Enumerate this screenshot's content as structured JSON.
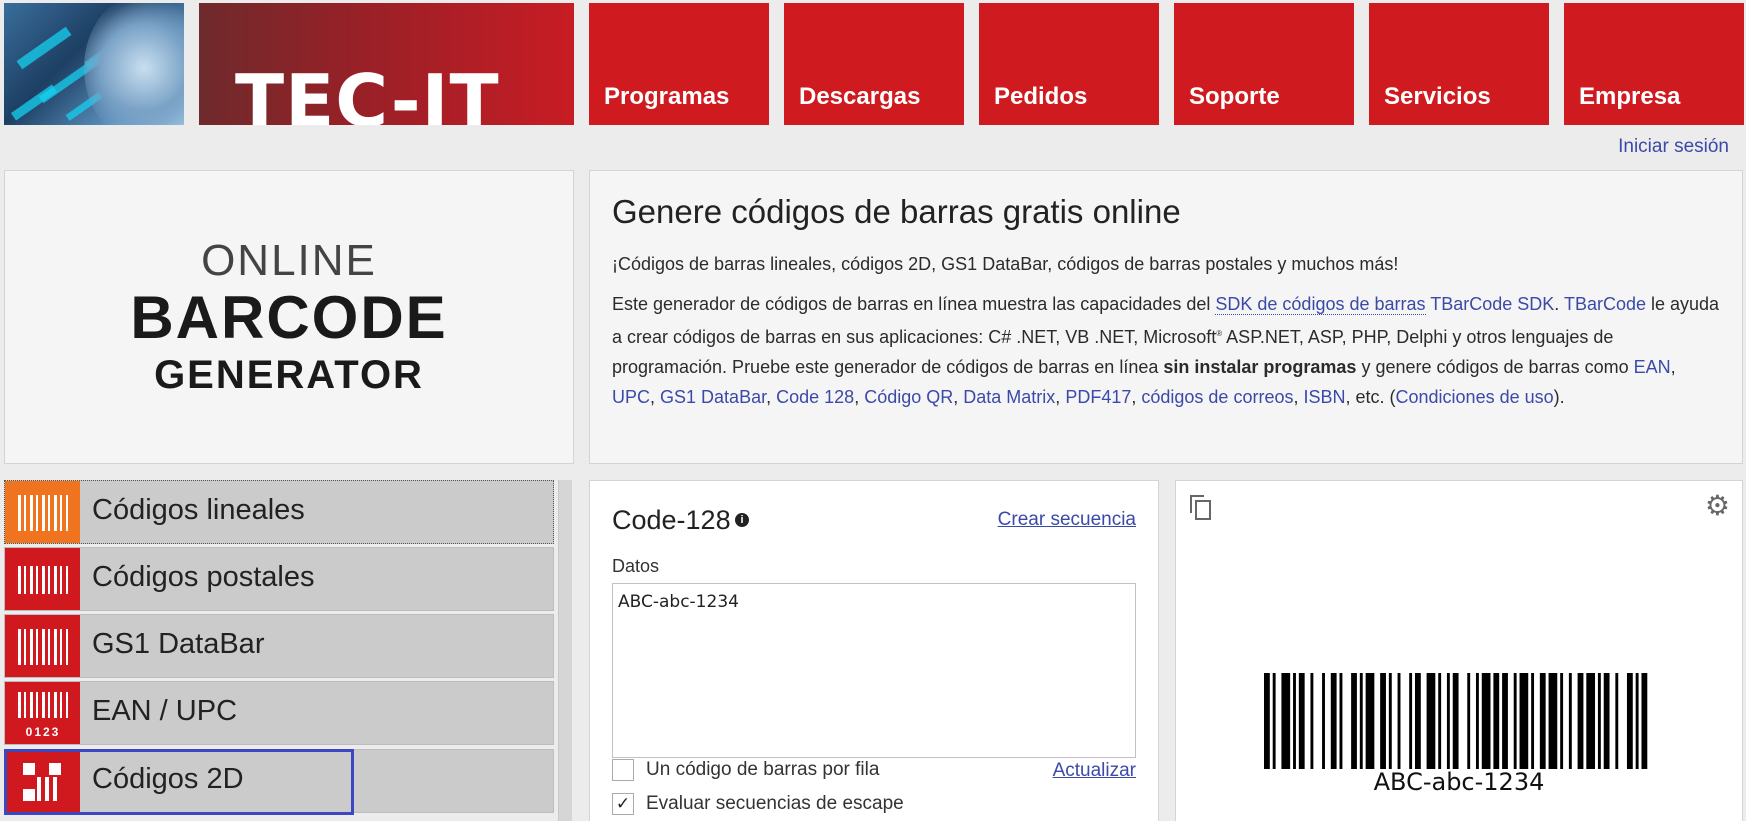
{
  "header": {
    "brand": "TEC-IT",
    "nav": [
      "Programas",
      "Descargas",
      "Pedidos",
      "Soporte",
      "Servicios",
      "Empresa"
    ],
    "login": "Iniciar sesión"
  },
  "logo": {
    "line1": "ONLINE",
    "line2": "BARCODE",
    "line3": "GENERATOR"
  },
  "intro": {
    "title": "Genere códigos de barras gratis online",
    "lead": "¡Códigos de barras lineales, códigos 2D, GS1 DataBar, códigos de barras postales y muchos más!",
    "p1": "Este generador de códigos de barras en línea muestra las capacidades del ",
    "link_sdk": "SDK de códigos de barras",
    "link_tbar_sdk": "TBarCode SDK",
    "link_tbar": "TBarCode",
    "p2": " le ayuda a crear códigos de barras en sus aplicaciones: C# .NET, VB .NET, Microsoft",
    "p3": " ASP.NET, ASP, PHP, Delphi y otros lenguajes de programación. Pruebe este generador de códigos de barras en línea ",
    "bold": "sin instalar programas",
    "p4": " y genere códigos de barras como ",
    "links": [
      "EAN",
      "UPC",
      "GS1 DataBar",
      "Code 128",
      "Código QR",
      "Data Matrix",
      "PDF417",
      "códigos de correos",
      "ISBN"
    ],
    "etc": ", etc. (",
    "terms": "Condiciones de uso",
    "end": ")."
  },
  "categories": [
    {
      "label": "Códigos lineales",
      "icon": "linear-barcode-icon"
    },
    {
      "label": "Códigos postales",
      "icon": "postal-barcode-icon"
    },
    {
      "label": "GS1 DataBar",
      "icon": "gs1-databar-icon"
    },
    {
      "label": "EAN / UPC",
      "icon": "ean-upc-icon",
      "digits": "0123"
    },
    {
      "label": "Códigos 2D",
      "icon": "qr-code-icon"
    }
  ],
  "form": {
    "title": "Code-128",
    "info": "i",
    "create_sequence": "Crear secuencia",
    "data_label": "Datos",
    "data_value": "ABC-abc-1234",
    "one_per_row": "Un código de barras por fila",
    "one_per_row_checked": false,
    "update": "Actualizar",
    "escape": "Evaluar secuencias de escape",
    "escape_checked": true,
    "check_mark": "✓"
  },
  "preview": {
    "barcode_text": "ABC-abc-1234",
    "gear": "⚙"
  },
  "colors": {
    "brand_red": "#cf1a20",
    "orange": "#f07420",
    "link": "#3b49a8",
    "selection": "#3d47c4"
  }
}
